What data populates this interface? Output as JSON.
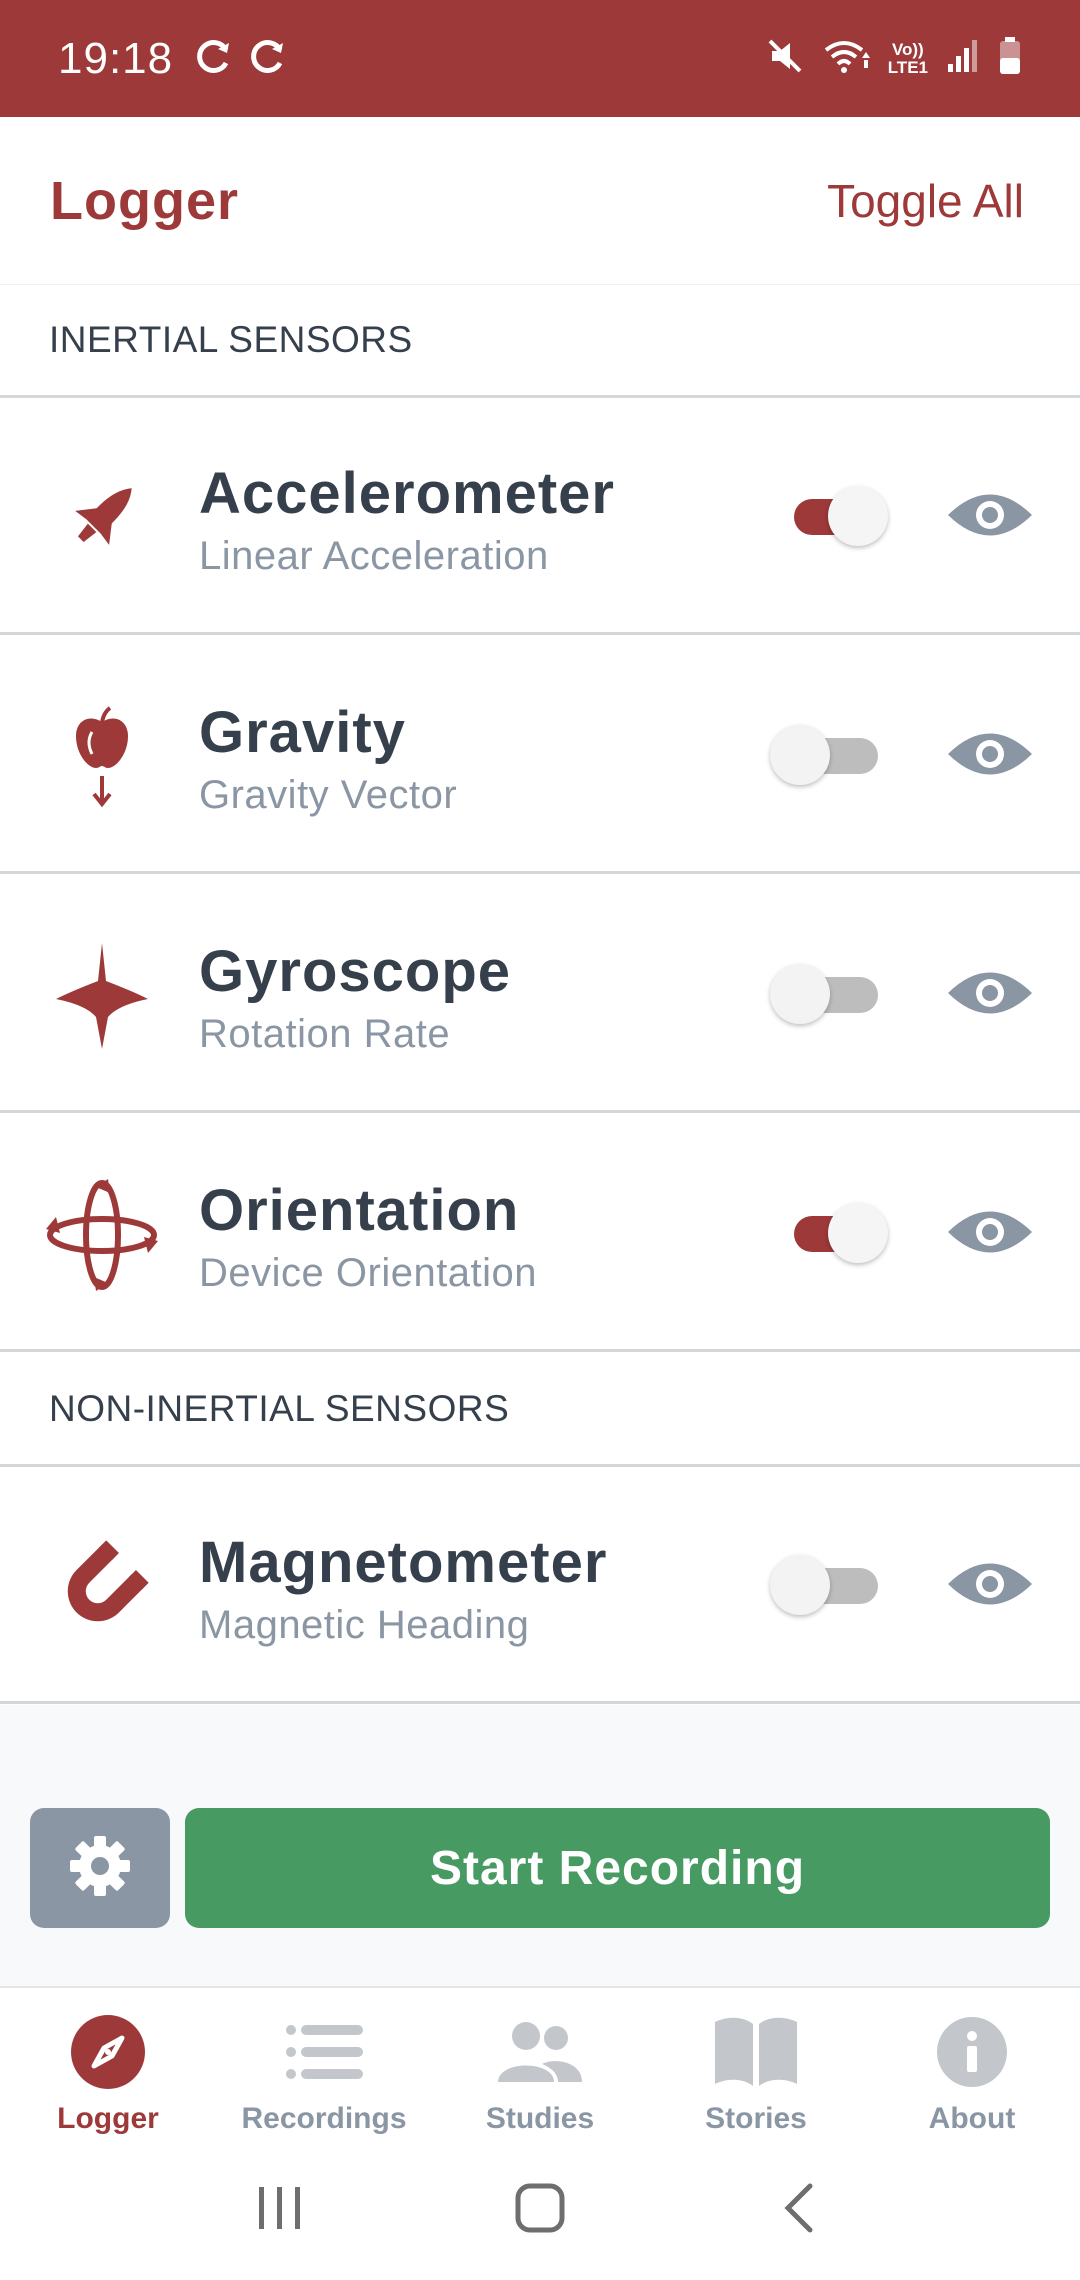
{
  "status_bar": {
    "time": "19:18",
    "lte_label_top": "Vo))",
    "lte_label_bottom": "LTE1"
  },
  "header": {
    "title": "Logger",
    "toggle_all": "Toggle All"
  },
  "sections": {
    "inertial": "INERTIAL SENSORS",
    "non_inertial": "NON-INERTIAL SENSORS"
  },
  "sensors": [
    {
      "name": "Accelerometer",
      "subtitle": "Linear Acceleration",
      "icon": "rocket-icon",
      "enabled": true
    },
    {
      "name": "Gravity",
      "subtitle": "Gravity Vector",
      "icon": "apple-icon",
      "enabled": false
    },
    {
      "name": "Gyroscope",
      "subtitle": "Rotation Rate",
      "icon": "spinning-top-icon",
      "enabled": false
    },
    {
      "name": "Orientation",
      "subtitle": "Device Orientation",
      "icon": "orientation-icon",
      "enabled": true
    },
    {
      "name": "Magnetometer",
      "subtitle": "Magnetic Heading",
      "icon": "magnet-icon",
      "enabled": false
    }
  ],
  "actions": {
    "record_label": "Start Recording"
  },
  "nav": [
    {
      "label": "Logger",
      "icon": "compass-icon",
      "active": true
    },
    {
      "label": "Recordings",
      "icon": "list-icon",
      "active": false
    },
    {
      "label": "Studies",
      "icon": "users-icon",
      "active": false
    },
    {
      "label": "Stories",
      "icon": "book-icon",
      "active": false
    },
    {
      "label": "About",
      "icon": "info-icon",
      "active": false
    }
  ],
  "colors": {
    "brand": "#9e3939",
    "text_primary": "#36404c",
    "text_secondary": "#8a96a3",
    "record_green": "#489a63"
  }
}
